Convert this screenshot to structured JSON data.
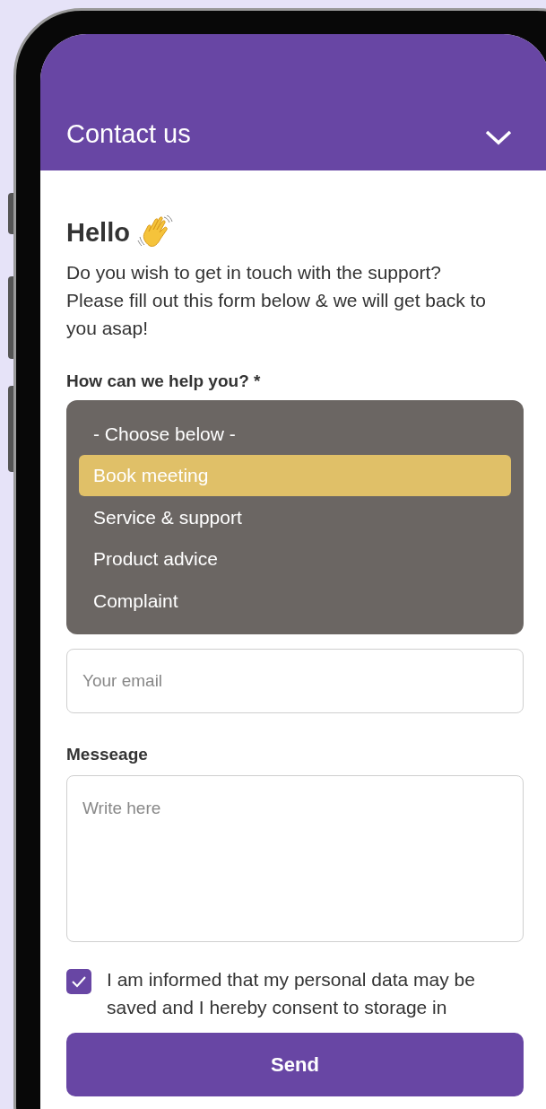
{
  "header": {
    "title": "Contact us",
    "expanded": true
  },
  "greeting": {
    "title": "Hello",
    "text": "Do you wish to get in touch with the support? Please fill out this form below & we will get back to you asap!"
  },
  "help_field": {
    "label": "How can we help you? *",
    "options": [
      {
        "label": "- Choose below -",
        "selected": false
      },
      {
        "label": "Book meeting",
        "selected": true
      },
      {
        "label": "Service & support",
        "selected": false
      },
      {
        "label": "Product advice",
        "selected": false
      },
      {
        "label": "Complaint",
        "selected": false
      }
    ]
  },
  "email_field": {
    "placeholder": "Your email"
  },
  "message_field": {
    "label": "Messeage",
    "placeholder": "Write here"
  },
  "consent": {
    "checked": true,
    "text": "I am informed that my personal data may be saved and I hereby consent to storage in"
  },
  "send_button": "Send"
}
